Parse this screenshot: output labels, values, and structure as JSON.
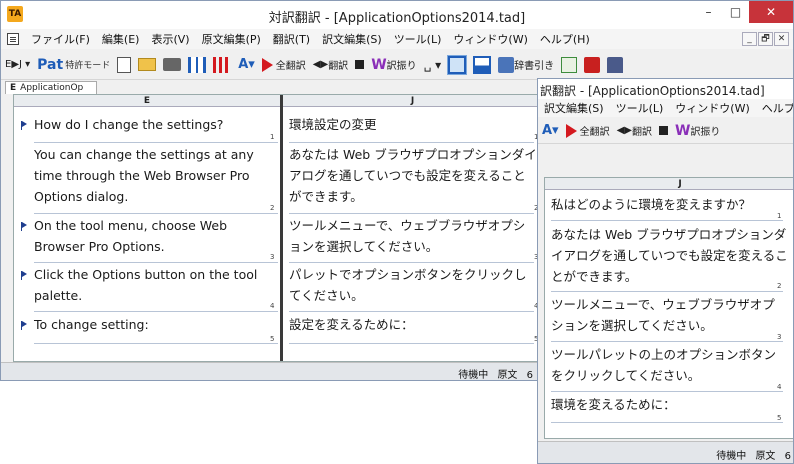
{
  "main": {
    "title": "対訳翻訳 - [ApplicationOptions2014.tad]",
    "app_icon": "TA",
    "window_buttons": {
      "minimize": "–",
      "maximize": "□",
      "close": "✕"
    },
    "menu": [
      "ファイル(F)",
      "編集(E)",
      "表示(V)",
      "原文編集(P)",
      "翻訳(T)",
      "訳文編集(S)",
      "ツール(L)",
      "ウィンドウ(W)",
      "ヘルプ(H)"
    ],
    "mdi_buttons": [
      "_",
      "🗗",
      "✕"
    ],
    "toolbar": {
      "ej": "E▶J ▾",
      "pat": "Pat",
      "patent_mode": "特許モード",
      "full_translate": "全翻訳",
      "translate": "翻訳",
      "yakufuri": "訳振り",
      "dictionary": "辞書引き",
      "underline": "␣ ▾"
    },
    "tab": {
      "col": "E",
      "name": "ApplicationOp"
    },
    "headers": {
      "left": "E",
      "right": "J"
    },
    "rows": [
      {
        "num": "1",
        "left": "How do I change the settings?",
        "right": "環境設定の変更"
      },
      {
        "num": "2",
        "left": "You can change the settings at any time through the Web Browser Pro Options dialog.",
        "right": "あなたは Web ブラウザプロオプションダイアログを通していつでも設定を変えることができます。"
      },
      {
        "num": "3",
        "left": "On the tool menu, choose Web Browser Pro Options.",
        "right": "ツールメニューで、ウェブブラウザオプションを選択してください。"
      },
      {
        "num": "4",
        "left": "Click the Options button on the tool palette.",
        "right": "パレットでオプションボタンをクリックしてください。"
      },
      {
        "num": "5",
        "left": "To change setting:",
        "right": "設定を変えるために："
      }
    ],
    "status": {
      "state": "待機中",
      "mode": "原文",
      "page": "6"
    }
  },
  "second": {
    "title": "訳翻訳 - [ApplicationOptions2014.tad]",
    "menu": [
      "訳文編集(S)",
      "ツール(L)",
      "ウィンドウ(W)",
      "ヘルプ(H)"
    ],
    "toolbar": {
      "full_translate": "全翻訳",
      "translate": "翻訳",
      "yakufuri": "訳振り"
    },
    "header": "J",
    "rows": [
      {
        "num": "1",
        "text": "私はどのように環境を変えますか？"
      },
      {
        "num": "2",
        "text": "あなたは Web ブラウザプロオプションダイアログを通していつでも設定を変えることができます。"
      },
      {
        "num": "3",
        "text": "ツールメニューで、ウェブブラウザオプションを選択してください。"
      },
      {
        "num": "4",
        "text": "ツールパレットの上のオプションボタンをクリックしてください。"
      },
      {
        "num": "5",
        "text": "環境を変えるために："
      }
    ],
    "status": {
      "state": "待機中",
      "mode": "原文",
      "page": "6"
    }
  },
  "colors": {
    "accent": "#1f5db8",
    "close": "#c7333a",
    "marker": "#1f3e8f"
  }
}
